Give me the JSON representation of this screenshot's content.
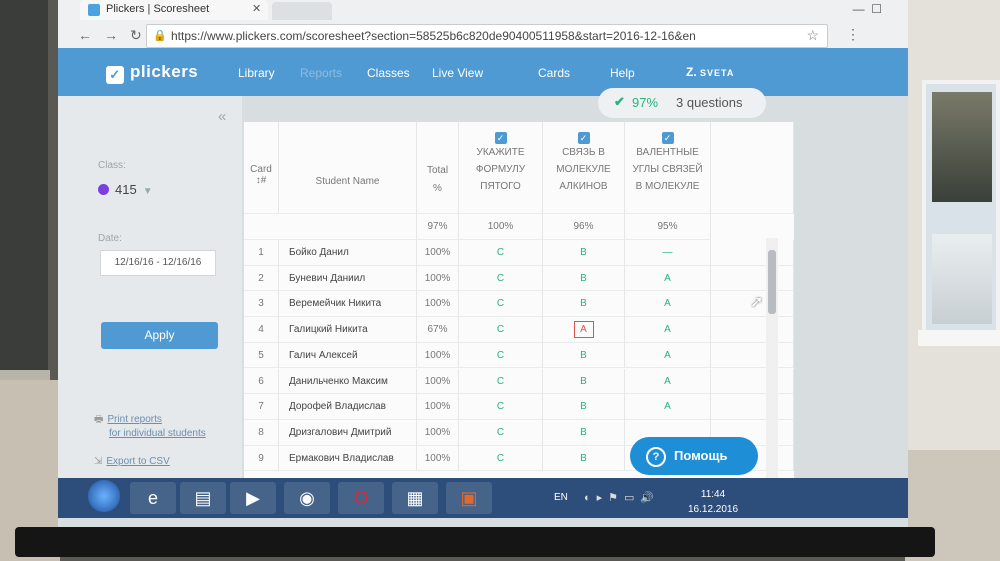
{
  "browser": {
    "tab_title": "Plickers | Scoresheet",
    "url": "https://www.plickers.com/scoresheet?section=58525b6c820de90400511958&start=2016-12-16&en"
  },
  "topnav": {
    "brand": "plickers",
    "items": [
      "Library",
      "Reports",
      "Classes",
      "Live View",
      "Cards",
      "Help"
    ],
    "user": "Z.",
    "user_sub": "SVETA"
  },
  "sidebar": {
    "class_label": "Class:",
    "class_value": "415",
    "class_color": "#7a3fe0",
    "date_label": "Date:",
    "date_value": "12/16/16 - 12/16/16",
    "apply": "Apply",
    "print_link_1": "Print reports",
    "print_link_2": "for individual students",
    "export_link": "Export to CSV"
  },
  "summary": {
    "percent": "97%",
    "questions": "3 questions"
  },
  "table": {
    "col_card": "Card",
    "col_card_sort": "#",
    "col_name": "Student Name",
    "col_total": "Total",
    "col_total_unit": "%",
    "questions": [
      {
        "lines": [
          "УКАЖИТЕ",
          "ФОРМУЛУ",
          "ПЯТОГО"
        ],
        "percent": "100%"
      },
      {
        "lines": [
          "СВЯЗЬ В",
          "МОЛЕКУЛЕ",
          "АЛКИНОВ"
        ],
        "percent": "96%"
      },
      {
        "lines": [
          "ВАЛЕНТНЫЕ",
          "УГЛЫ СВЯЗЕЙ",
          "В МОЛЕКУЛЕ"
        ],
        "percent": "95%"
      }
    ],
    "total_percent": "97%",
    "rows": [
      {
        "card": "1",
        "name": "Бойко Данил",
        "total": "100%",
        "a": [
          "C",
          "B",
          "—"
        ]
      },
      {
        "card": "2",
        "name": "Буневич Даниил",
        "total": "100%",
        "a": [
          "C",
          "B",
          "A"
        ]
      },
      {
        "card": "3",
        "name": "Веремейчик Никита",
        "total": "100%",
        "a": [
          "C",
          "B",
          "A"
        ]
      },
      {
        "card": "4",
        "name": "Галицкий Никита",
        "total": "67%",
        "a": [
          "C",
          "A",
          "A"
        ]
      },
      {
        "card": "5",
        "name": "Галич Алексей",
        "total": "100%",
        "a": [
          "C",
          "B",
          "A"
        ]
      },
      {
        "card": "6",
        "name": "Данильченко Максим",
        "total": "100%",
        "a": [
          "C",
          "B",
          "A"
        ]
      },
      {
        "card": "7",
        "name": "Дорофей Владислав",
        "total": "100%",
        "a": [
          "C",
          "B",
          "A"
        ]
      },
      {
        "card": "8",
        "name": "Дризгалович Дмитрий",
        "total": "100%",
        "a": [
          "C",
          "B",
          ""
        ]
      },
      {
        "card": "9",
        "name": "Ермакович Владислав",
        "total": "100%",
        "a": [
          "C",
          "B",
          ""
        ]
      }
    ]
  },
  "help_button": "Помощь",
  "taskbar": {
    "lang": "EN",
    "time": "11:44",
    "date": "16.12.2016"
  }
}
